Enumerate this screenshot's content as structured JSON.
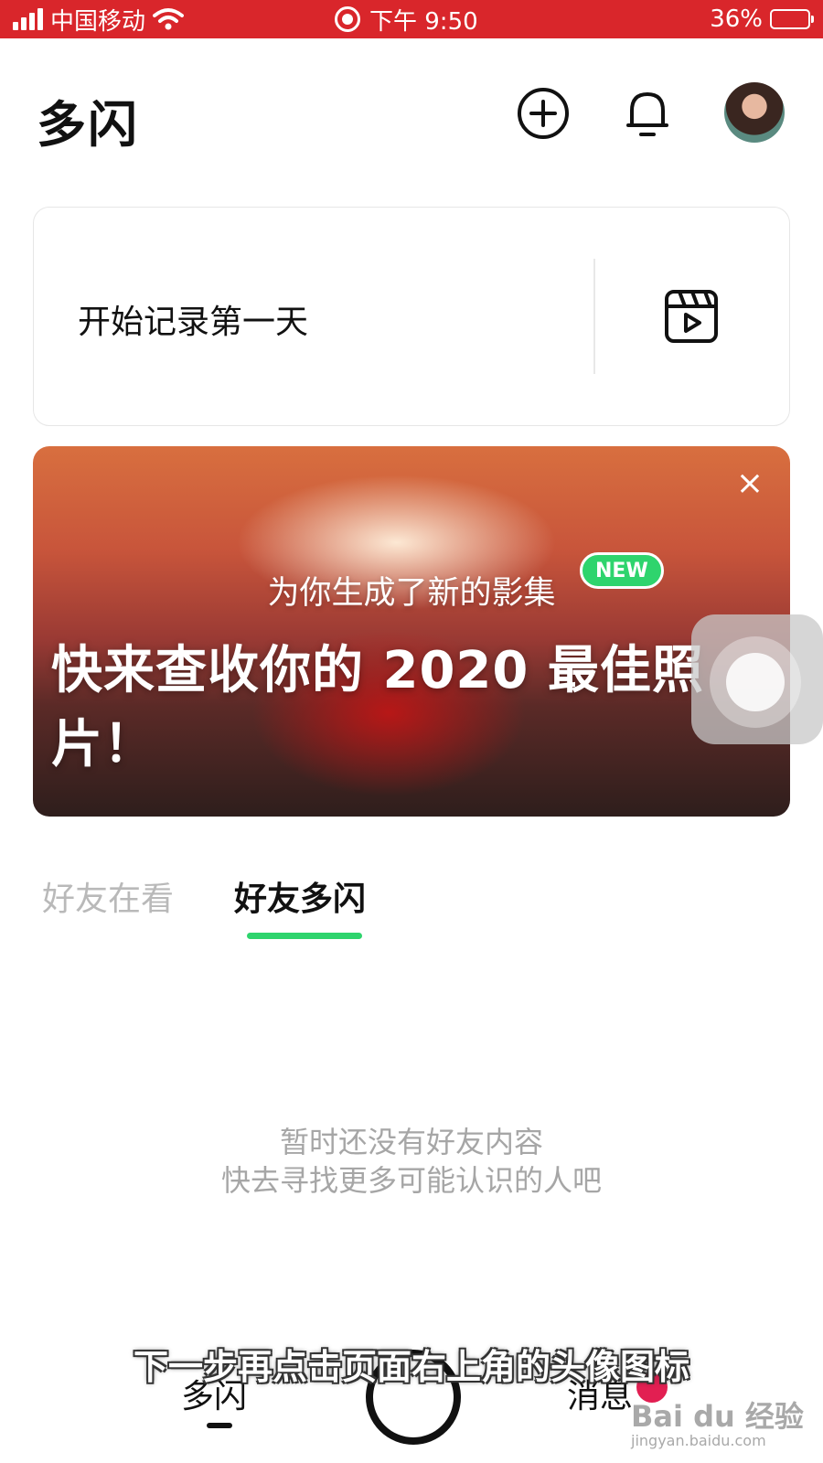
{
  "status_bar": {
    "carrier": "中国移动",
    "time": "下午 9:50",
    "battery": "36%",
    "battery_level": 0.36
  },
  "header": {
    "title": "多闪",
    "icons": [
      "add-circle-icon",
      "bell-icon",
      "avatar"
    ]
  },
  "record_card": {
    "text": "开始记录第一天",
    "icon": "clapperboard-icon"
  },
  "banner": {
    "badge": "NEW",
    "subtitle": "为你生成了新的影集",
    "headline": "快来查收你的 2020 最佳照片！",
    "close": "×"
  },
  "tabs": [
    {
      "label": "好友在看",
      "active": false
    },
    {
      "label": "好友多闪",
      "active": true
    }
  ],
  "empty_state": {
    "line1": "暂时还没有好友内容",
    "line2": "快去寻找更多可能认识的人吧"
  },
  "bottom_nav": {
    "home": "多闪",
    "messages": "消息"
  },
  "overlay": {
    "subtitle": "下一步再点击页面右上角的头像图标",
    "watermark": "Bai du 经验",
    "watermark_url": "jingyan.baidu.com"
  },
  "colors": {
    "status_bar": "#d9262b",
    "accent_green": "#2ed46d",
    "badge_red": "#e21f52"
  }
}
